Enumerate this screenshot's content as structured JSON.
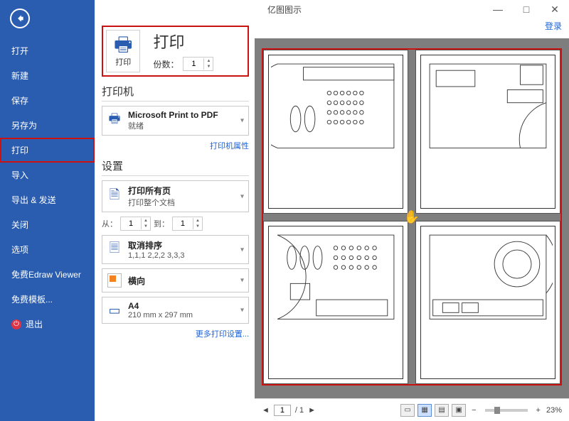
{
  "titlebar": {
    "app_name": "亿图图示"
  },
  "window_controls": {
    "minimize": "—",
    "maximize": "□",
    "close": "✕"
  },
  "header": {
    "login": "登录"
  },
  "sidebar": {
    "items": [
      {
        "label": "打开"
      },
      {
        "label": "新建"
      },
      {
        "label": "保存"
      },
      {
        "label": "另存为"
      },
      {
        "label": "打印",
        "selected": true
      },
      {
        "label": "导入"
      },
      {
        "label": "导出 & 发送"
      },
      {
        "label": "关闭"
      },
      {
        "label": "选项"
      },
      {
        "label": "免费Edraw Viewer"
      },
      {
        "label": "免费模板..."
      }
    ],
    "exit": "退出"
  },
  "print": {
    "icon_label": "打印",
    "title": "打印",
    "copies_label": "份数：",
    "copies_value": "1"
  },
  "printer": {
    "section": "打印机",
    "name": "Microsoft Print to PDF",
    "status": "就绪",
    "properties": "打印机属性"
  },
  "settings": {
    "section": "设置",
    "pages": {
      "title": "打印所有页",
      "sub": "打印整个文档"
    },
    "range": {
      "from_label": "从：",
      "from": "1",
      "to_label": "到：",
      "to": "1"
    },
    "collate": {
      "title": "取消排序",
      "sub": "1,1,1  2,2,2  3,3,3"
    },
    "orientation": {
      "title": "横向"
    },
    "paper": {
      "title": "A4",
      "sub": "210 mm x 297 mm"
    },
    "more": "更多打印设置..."
  },
  "pager": {
    "page": "1",
    "total": "/ 1",
    "zoom": "23%"
  }
}
